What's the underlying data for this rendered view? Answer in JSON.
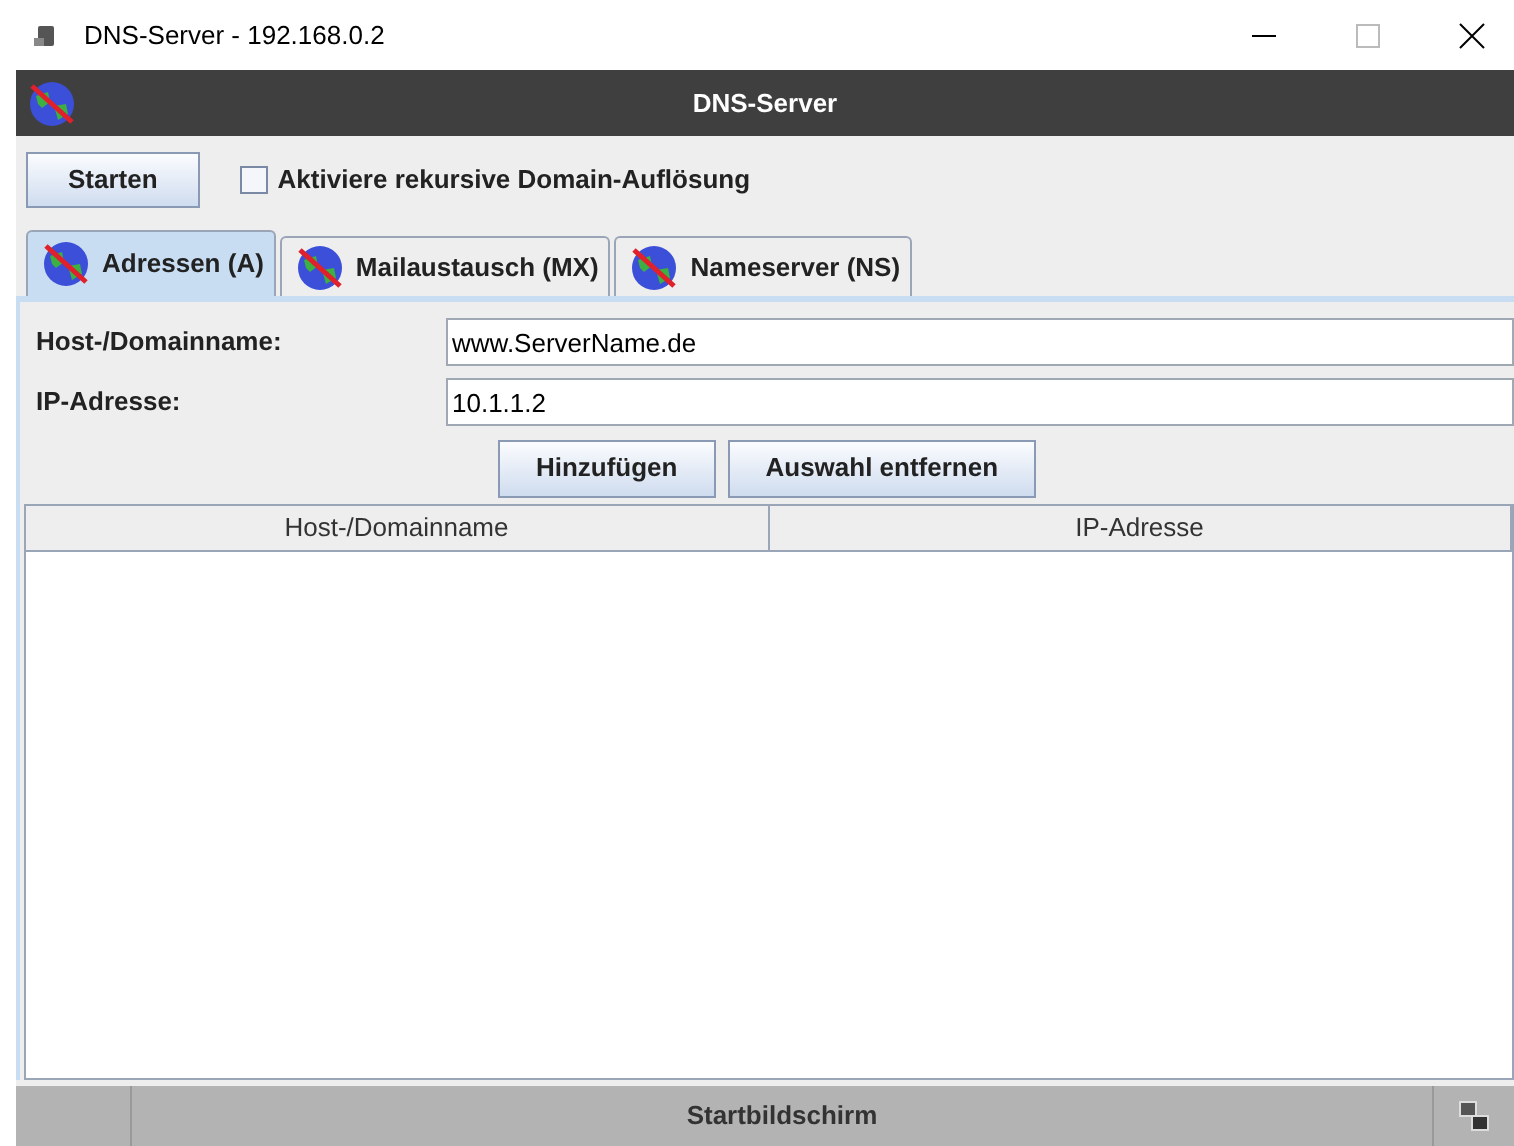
{
  "window": {
    "title": "DNS-Server - 192.168.0.2"
  },
  "header": {
    "title": "DNS-Server"
  },
  "toolbar": {
    "start_button": "Starten",
    "recursive_checkbox": {
      "label": "Aktiviere rekursive Domain-Auflösung",
      "checked": false
    }
  },
  "tabs": [
    {
      "label": "Adressen (A)",
      "selected": true
    },
    {
      "label": "Mailaustausch (MX)",
      "selected": false
    },
    {
      "label": "Nameserver (NS)",
      "selected": false
    }
  ],
  "form": {
    "fields": [
      {
        "label": "Host-/Domainname:",
        "value": "www.ServerName.de"
      },
      {
        "label": "IP-Adresse:",
        "value": "10.1.1.2"
      }
    ],
    "buttons": [
      "Hinzufügen",
      "Auswahl entfernen"
    ]
  },
  "table": {
    "columns": [
      "Host-/Domainname",
      "IP-Adresse"
    ]
  },
  "status_bar": {
    "title": "Startbildschirm"
  }
}
